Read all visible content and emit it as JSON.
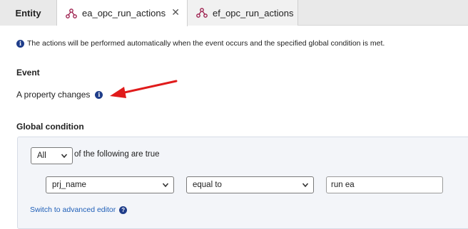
{
  "tabs": {
    "entity": "Entity",
    "active": "ea_opc_run_actions",
    "inactive": "ef_opc_run_actions",
    "close_glyph": "✕"
  },
  "info": {
    "icon": "info-icon",
    "text": "The actions will be performed automatically when the event occurs and the specified global condition is met."
  },
  "event": {
    "title": "Event",
    "value": "A property changes"
  },
  "global_condition": {
    "title": "Global condition",
    "quantifier": "All",
    "quantifier_suffix": "of the following are true",
    "rule": {
      "property": "prj_name",
      "operator": "equal to",
      "value": "run ea"
    },
    "advanced_link": "Switch to advanced editor",
    "help_glyph": "?"
  },
  "colors": {
    "accent": "#1f3d8a",
    "link": "#1f5fb8",
    "arrow": "#e01b1b",
    "tab_icon": "#9b1a4a"
  }
}
